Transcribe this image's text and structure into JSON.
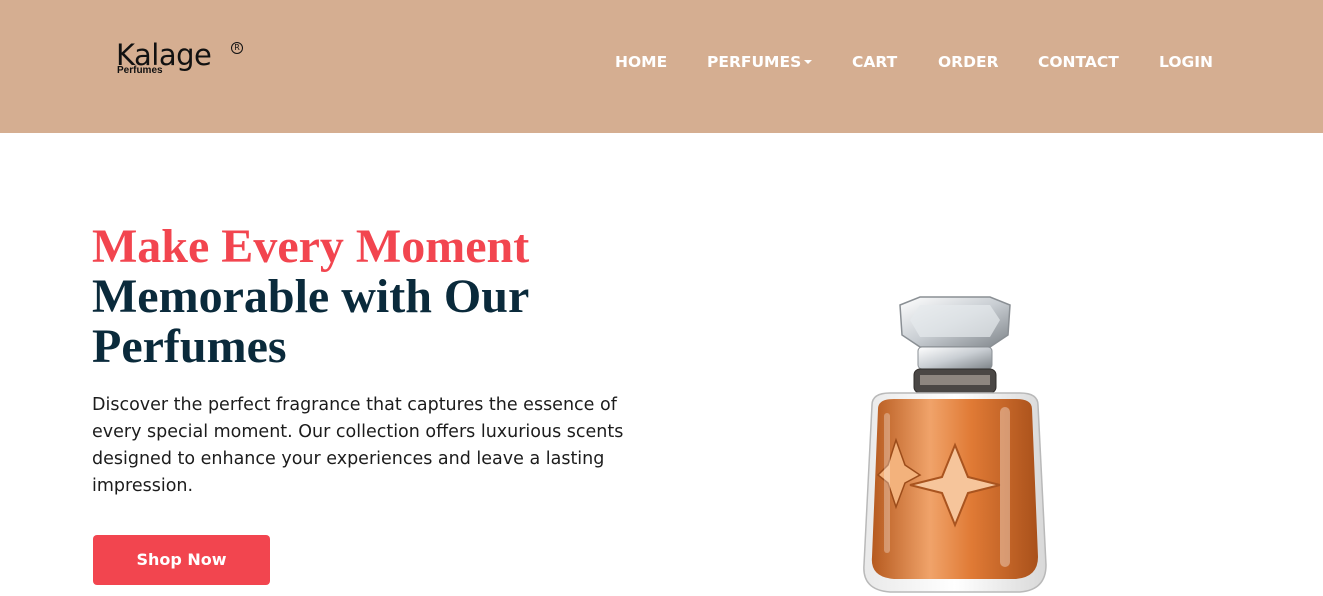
{
  "brand": {
    "name": "Kalage",
    "tagline": "Perfumes",
    "mark": "R"
  },
  "nav": {
    "items": [
      {
        "label": "HOME"
      },
      {
        "label": "PERFUMES"
      },
      {
        "label": "CART"
      },
      {
        "label": "ORDER"
      },
      {
        "label": "CONTACT"
      },
      {
        "label": "LOGIN"
      }
    ]
  },
  "hero": {
    "title_accent": "Make Every Moment",
    "title_rest": "Memorable with Our Perfumes",
    "description": "Discover the perfect fragrance that captures the essence of every special moment. Our collection offers luxurious scents designed to enhance your experiences and leave a lasting impression.",
    "cta_label": "Shop Now",
    "image_icon": "perfume-bottle-icon"
  },
  "colors": {
    "navbar_bg": "#d5ae91",
    "accent": "#f2454f",
    "heading": "#0a2a3b",
    "nav_text": "#ffffff"
  }
}
